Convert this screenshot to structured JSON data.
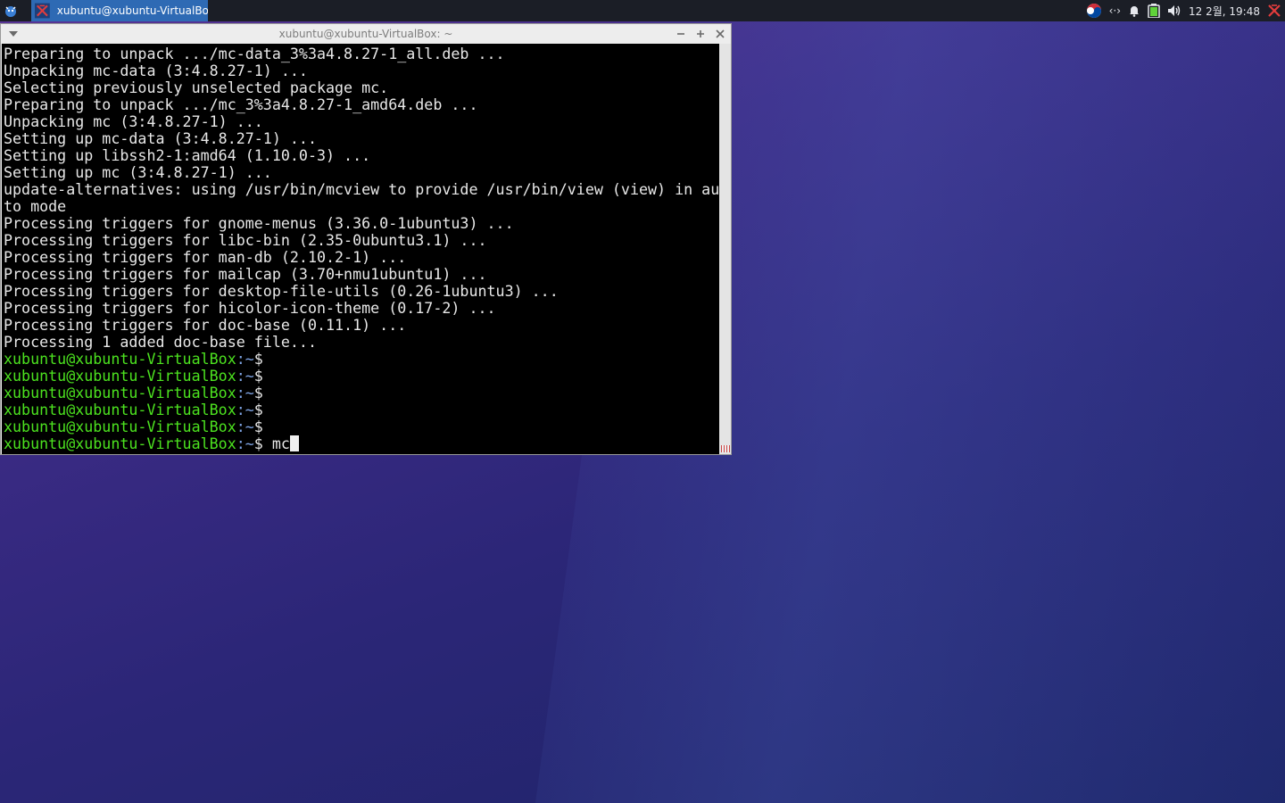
{
  "panel": {
    "taskbar_label": "xubuntu@xubuntu-VirtualBo...",
    "datetime": "12 2월, 19:48",
    "network_glyph": "‹·›"
  },
  "window": {
    "title": "xubuntu@xubuntu-VirtualBox: ~"
  },
  "terminal": {
    "output_lines": [
      "Preparing to unpack .../mc-data_3%3a4.8.27-1_all.deb ...",
      "Unpacking mc-data (3:4.8.27-1) ...",
      "Selecting previously unselected package mc.",
      "Preparing to unpack .../mc_3%3a4.8.27-1_amd64.deb ...",
      "Unpacking mc (3:4.8.27-1) ...",
      "Setting up mc-data (3:4.8.27-1) ...",
      "Setting up libssh2-1:amd64 (1.10.0-3) ...",
      "Setting up mc (3:4.8.27-1) ...",
      "update-alternatives: using /usr/bin/mcview to provide /usr/bin/view (view) in au",
      "to mode",
      "Processing triggers for gnome-menus (3.36.0-1ubuntu3) ...",
      "Processing triggers for libc-bin (2.35-0ubuntu3.1) ...",
      "Processing triggers for man-db (2.10.2-1) ...",
      "Processing triggers for mailcap (3.70+nmu1ubuntu1) ...",
      "Processing triggers for desktop-file-utils (0.26-1ubuntu3) ...",
      "Processing triggers for hicolor-icon-theme (0.17-2) ...",
      "Processing triggers for doc-base (0.11.1) ...",
      "Processing 1 added doc-base file..."
    ],
    "prompt_user": "xubuntu@xubuntu-VirtualBox",
    "prompt_path": ":~",
    "prompt_symbol": "$",
    "empty_prompts": 5,
    "current_command": " mc"
  },
  "colors": {
    "prompt_user": "#4ce21f",
    "prompt_path": "#7fa5e6",
    "taskbar_active": "#2e6ab4",
    "terminal_bg": "#000000"
  },
  "icons": {
    "whisker": "whisker-menu-icon",
    "task": "xubuntu-terminal-icon",
    "tray": [
      "keyboard-layout-icon",
      "network-icon",
      "notification-bell-icon",
      "battery-icon",
      "volume-icon",
      "xubuntu-logo-icon"
    ]
  }
}
